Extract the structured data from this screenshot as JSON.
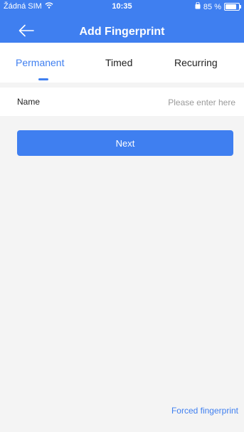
{
  "status_bar": {
    "carrier": "Žádná SIM",
    "time": "10:35",
    "battery_text": "85 %",
    "battery_level": 0.85
  },
  "header": {
    "title": "Add Fingerprint",
    "back_icon": "arrow-left-icon",
    "color": "#3f7ff0"
  },
  "tabs": [
    {
      "label": "Permanent",
      "active": true
    },
    {
      "label": "Timed",
      "active": false
    },
    {
      "label": "Recurring",
      "active": false
    }
  ],
  "form": {
    "name_label": "Name",
    "name_placeholder": "Please enter here",
    "name_value": ""
  },
  "actions": {
    "next_label": "Next",
    "forced_label": "Forced fingerprint"
  }
}
